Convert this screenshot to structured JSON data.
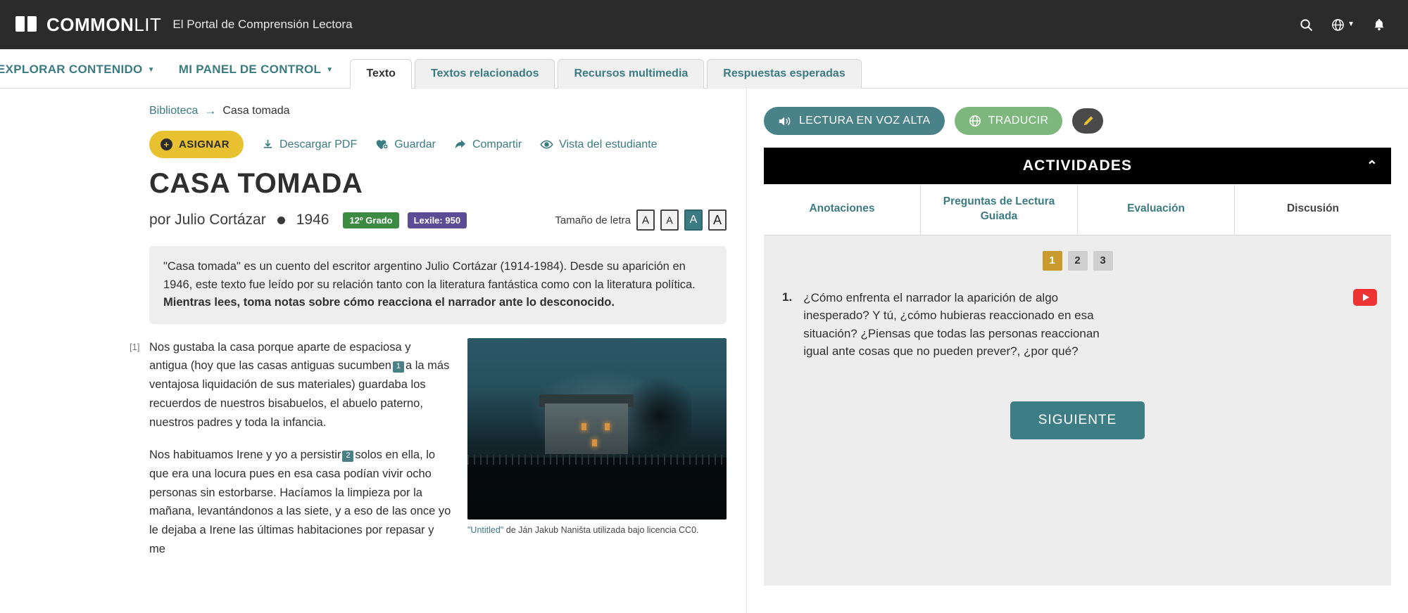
{
  "header": {
    "logo_main": "COMMON",
    "logo_light": "LIT",
    "tagline": "El Portal de Comprensión Lectora",
    "search_icon": "search-icon",
    "language_icon": "globe-icon",
    "notification_icon": "bell-icon"
  },
  "nav": {
    "links": [
      {
        "label": "EXPLORAR CONTENIDO",
        "caret": "▼"
      },
      {
        "label": "MI PANEL DE CONTROL",
        "caret": "▼"
      }
    ],
    "tabs": [
      {
        "label": "Texto",
        "active": true
      },
      {
        "label": "Textos relacionados",
        "active": false
      },
      {
        "label": "Recursos multimedia",
        "active": false
      },
      {
        "label": "Respuestas esperadas",
        "active": false
      }
    ]
  },
  "breadcrumb": {
    "root": "Biblioteca",
    "arrow": "→",
    "current": "Casa tomada"
  },
  "actions": {
    "assign": "ASIGNAR",
    "assign_icon": "plus-circle-icon",
    "download": "Descargar PDF",
    "download_icon": "download-icon",
    "save": "Guardar",
    "save_icon": "heart-plus-icon",
    "share": "Compartir",
    "share_icon": "share-arrow-icon",
    "student_view": "Vista del estudiante",
    "student_view_icon": "eye-icon"
  },
  "article": {
    "title": "CASA TOMADA",
    "byline": "por Julio Cortázar",
    "year": "1946",
    "grade_badge": "12º Grado",
    "lexile_badge": "Lexile: 950",
    "fontsize_label": "Tamaño de letra",
    "fontsize_options": [
      "A",
      "A",
      "A",
      "A"
    ],
    "fontsize_selected_index": 2,
    "intro_part1": "\"Casa tomada\" es un cuento del escritor argentino Julio Cortázar (1914-1984). Desde su aparición en 1946, este texto fue leído por su relación tanto con la literatura fantástica como con la literatura política. ",
    "intro_bold": "Mientras lees, toma notas sobre cómo reacciona el narrador ante lo desconocido.",
    "paragraphs": [
      {
        "number": "[1]",
        "text_a": "Nos gustaba la casa porque aparte de espaciosa y antigua (hoy que las casas antiguas sucumben",
        "annot": "1",
        "text_b": "a la más ventajosa liquidación de sus materiales) guardaba los recuerdos de nuestros bisabuelos, el abuelo paterno, nuestros padres y toda la infancia."
      },
      {
        "number": "",
        "text_a": "Nos habituamos Irene y yo a persistir",
        "annot": "2",
        "text_b": "solos en ella, lo que era una locura pues en esa casa podían vivir ocho personas sin estorbarse. Hacíamos la limpieza por la mañana, levantándonos a las siete, y a eso de las once yo le dejaba a Irene las últimas habitaciones por repasar y me"
      }
    ],
    "image_caption_link": "\"Untitled\"",
    "image_caption_rest": " de Ján Jakub Naništa utilizada bajo licencia CC0."
  },
  "sidebar": {
    "read_aloud": "LECTURA EN VOZ ALTA",
    "read_aloud_icon": "speaker-icon",
    "translate": "TRADUCIR",
    "translate_icon": "globe-translate-icon",
    "pencil_icon": "highlighter-icon",
    "activities_title": "ACTIVIDADES",
    "collapse_icon": "chevron-up-icon",
    "tabs": [
      {
        "label": "Anotaciones"
      },
      {
        "label": "Preguntas de Lectura Guiada"
      },
      {
        "label": "Evaluación"
      },
      {
        "label": "Discusión"
      }
    ],
    "question_numbers": [
      "1",
      "2",
      "3"
    ],
    "active_question": "1",
    "question_index": "1.",
    "question_text": "¿Cómo enfrenta el narrador la aparición de algo inesperado? Y tú, ¿cómo hubieras reaccionado en esa situación? ¿Piensas que todas las personas reaccionan igual ante cosas que no pueden prever?, ¿por qué?",
    "video_icon": "youtube-play-icon",
    "next_button": "SIGUIENTE"
  },
  "colors": {
    "teal": "#3b7b82",
    "yellow": "#e8c131",
    "green_badge": "#3b8b43",
    "purple_badge": "#5b4c95",
    "dark_header": "#2b2b2b"
  }
}
